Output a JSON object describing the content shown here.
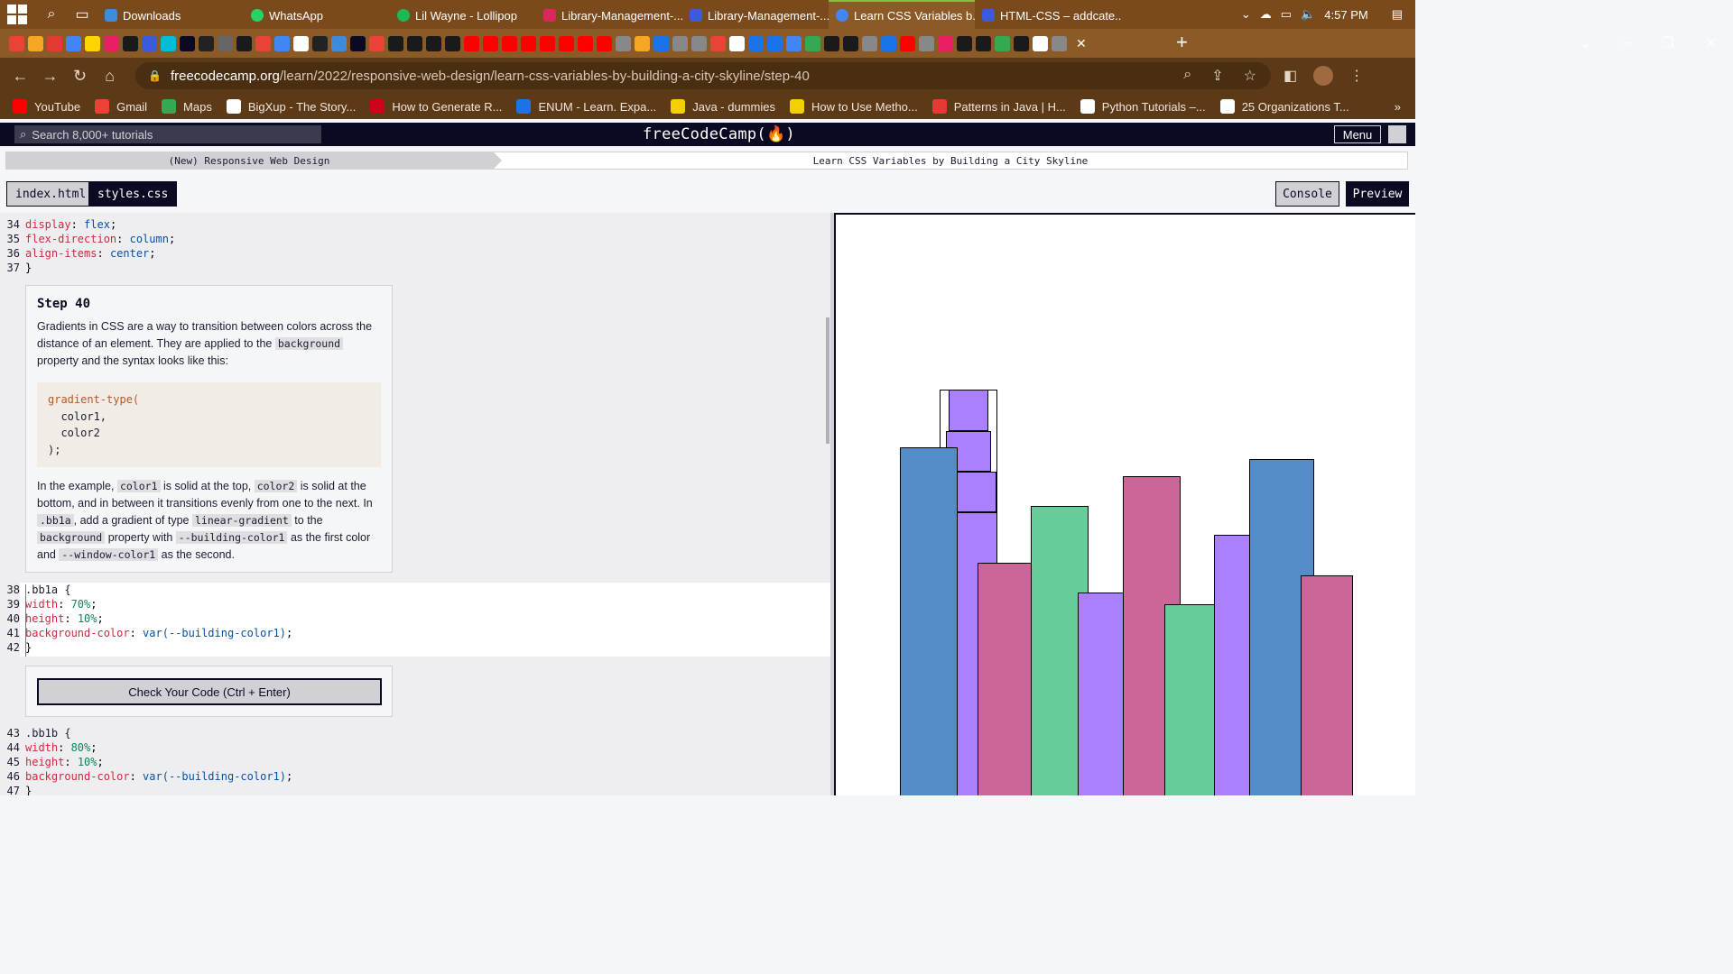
{
  "taskbar": {
    "tabs": [
      {
        "label": "Downloads",
        "color": "#3d8bd9"
      },
      {
        "label": "WhatsApp",
        "color": "#25d366"
      },
      {
        "label": "Lil Wayne - Lollipop",
        "color": "#1db954"
      },
      {
        "label": "Library-Management-...",
        "color": "#e0245e"
      },
      {
        "label": "Library-Management-...",
        "color": "#3b5bdb"
      },
      {
        "label": "Learn CSS Variables b...",
        "color": "#4285f4"
      },
      {
        "label": "HTML-CSS – addcate...",
        "color": "#3b5bdb"
      }
    ],
    "time": "4:57 PM"
  },
  "browser": {
    "url_host": "freecodecamp.org",
    "url_path": "/learn/2022/responsive-web-design/learn-css-variables-by-building-a-city-skyline/step-40"
  },
  "bookmarks": [
    {
      "label": "YouTube",
      "color": "#ff0000"
    },
    {
      "label": "Gmail",
      "color": "#ea4335"
    },
    {
      "label": "Maps",
      "color": "#34a853"
    },
    {
      "label": "BigXup - The Story...",
      "color": "#ffffff"
    },
    {
      "label": "How to Generate R...",
      "color": "#d0021b"
    },
    {
      "label": "ENUM - Learn. Expa...",
      "color": "#1a73e8"
    },
    {
      "label": "Java - dummies",
      "color": "#f5d000"
    },
    {
      "label": "How to Use Metho...",
      "color": "#f5d000"
    },
    {
      "label": "Patterns in Java | H...",
      "color": "#e53935"
    },
    {
      "label": "Python Tutorials –...",
      "color": "#ffffff"
    },
    {
      "label": "25 Organizations T...",
      "color": "#ffffff"
    }
  ],
  "fcc": {
    "search_placeholder": "Search 8,000+ tutorials",
    "logo": "freeCodeCamp(🔥)",
    "menu": "Menu",
    "breadcrumb_course": "(New) Responsive Web Design",
    "breadcrumb_project": "Learn CSS Variables by Building a City Skyline",
    "tab_index": "index.html",
    "tab_styles": "styles.css",
    "console": "Console",
    "preview": "Preview"
  },
  "step": {
    "title": "Step 40",
    "p1a": "Gradients in CSS are a way to transition between colors across the distance of an element. They are applied to the ",
    "p1_code": "background",
    "p1b": " property and the syntax looks like this:",
    "code_fn": "gradient-type(",
    "code_l2": "  color1,",
    "code_l3": "  color2",
    "code_l4": ");",
    "p2a": "In the example, ",
    "p2_c1": "color1",
    "p2b": " is solid at the top, ",
    "p2_c2": "color2",
    "p2c": " is solid at the bottom, and in between it transitions evenly from one to the next. In ",
    "p2_c3": ".bb1a",
    "p2d": ", add a gradient of type ",
    "p2_c4": "linear-gradient",
    "p2e": " to the ",
    "p2_c5": "background",
    "p2f": " property with ",
    "p2_c6": "--building-color1",
    "p2g": " as the first color and ",
    "p2_c7": "--window-color1",
    "p2h": " as the second.",
    "check_button": "Check Your Code (Ctrl + Enter)"
  },
  "code": {
    "before": [
      {
        "n": "34",
        "prop": "display",
        "val": "flex"
      },
      {
        "n": "35",
        "prop": "flex-direction",
        "val": "column"
      },
      {
        "n": "36",
        "prop": "align-items",
        "val": "center"
      }
    ],
    "l37": "37",
    "active": {
      "l38": "38",
      "sel": ".bb1a {",
      "l39": "39",
      "p39": "width",
      "v39": "70%",
      "l40": "40",
      "p40": "height",
      "v40": "10%",
      "l41": "41",
      "p41": "background-color",
      "v41": "var(--building-color1)",
      "l42": "42"
    },
    "after": {
      "l43": "43",
      "sel": ".bb1b {",
      "l44": "44",
      "p44": "width",
      "v44": "80%",
      "l45": "45",
      "p45": "height",
      "v45": "10%",
      "l46": "46",
      "p46": "background-color",
      "v46": "var(--building-color1)",
      "l47": "47"
    }
  },
  "preview_colors": {
    "building_color1": "#aa80ff",
    "building_color2": "#66cc99",
    "building_color3": "#cc6699",
    "building_color4": "#538cc6"
  }
}
